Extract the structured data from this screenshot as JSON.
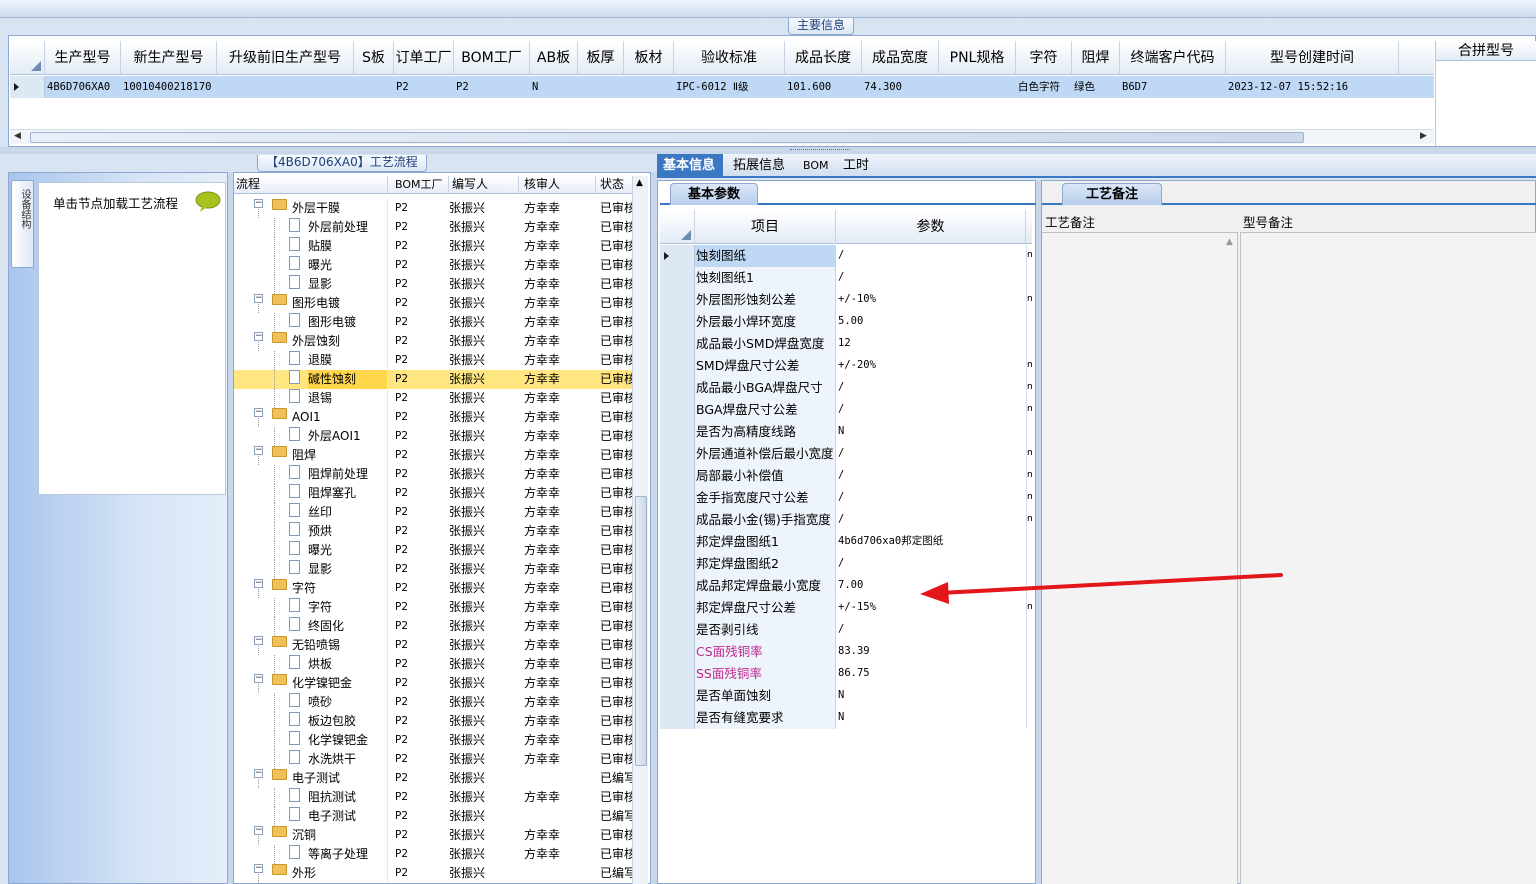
{
  "main_info": {
    "title": "主要信息",
    "combo_header": "合拼型号",
    "columns": [
      "生产型号",
      "新生产型号",
      "升级前旧生产型号",
      "S板",
      "订单工厂",
      "BOM工厂",
      "AB板",
      "板厚",
      "板材",
      "验收标准",
      "成品长度",
      "成品宽度",
      "PNL规格",
      "字符",
      "阻焊",
      "终端客户代码",
      "型号创建时间"
    ],
    "row": [
      "4B6D706XA0",
      "10010400218170",
      "",
      "",
      "P2",
      "P2",
      "N",
      "",
      "",
      "IPC-6012 Ⅱ级",
      "101.600",
      "74.300",
      "",
      "白色字符",
      "绿色",
      "B6D7",
      "2023-12-07 15:52:16"
    ]
  },
  "side": {
    "vertical_tab": "设备结构",
    "click_hint": "单击节点加载工艺流程"
  },
  "process": {
    "title": "【4B6D706XA0】工艺流程",
    "columns": [
      "流程",
      "BOM工厂",
      "编写人",
      "核审人",
      "状态"
    ],
    "rows": [
      {
        "level": 0,
        "name": "外层干膜",
        "factory": "P2",
        "writer": "张振兴",
        "checker": "方幸幸",
        "status": "已审核"
      },
      {
        "level": 1,
        "name": "外层前处理",
        "factory": "P2",
        "writer": "张振兴",
        "checker": "方幸幸",
        "status": "已审核"
      },
      {
        "level": 1,
        "name": "贴膜",
        "factory": "P2",
        "writer": "张振兴",
        "checker": "方幸幸",
        "status": "已审核"
      },
      {
        "level": 1,
        "name": "曝光",
        "factory": "P2",
        "writer": "张振兴",
        "checker": "方幸幸",
        "status": "已审核"
      },
      {
        "level": 1,
        "name": "显影",
        "factory": "P2",
        "writer": "张振兴",
        "checker": "方幸幸",
        "status": "已审核"
      },
      {
        "level": 0,
        "name": "图形电镀",
        "factory": "P2",
        "writer": "张振兴",
        "checker": "方幸幸",
        "status": "已审核"
      },
      {
        "level": 1,
        "name": "图形电镀",
        "factory": "P2",
        "writer": "张振兴",
        "checker": "方幸幸",
        "status": "已审核"
      },
      {
        "level": 0,
        "name": "外层蚀刻",
        "factory": "P2",
        "writer": "张振兴",
        "checker": "方幸幸",
        "status": "已审核"
      },
      {
        "level": 1,
        "name": "退膜",
        "factory": "P2",
        "writer": "张振兴",
        "checker": "方幸幸",
        "status": "已审核"
      },
      {
        "level": 1,
        "name": "碱性蚀刻",
        "factory": "P2",
        "writer": "张振兴",
        "checker": "方幸幸",
        "status": "已审核",
        "selected": true
      },
      {
        "level": 1,
        "name": "退锡",
        "factory": "P2",
        "writer": "张振兴",
        "checker": "方幸幸",
        "status": "已审核"
      },
      {
        "level": 0,
        "name": "AOI1",
        "factory": "P2",
        "writer": "张振兴",
        "checker": "方幸幸",
        "status": "已审核"
      },
      {
        "level": 1,
        "name": "外层AOI1",
        "factory": "P2",
        "writer": "张振兴",
        "checker": "方幸幸",
        "status": "已审核"
      },
      {
        "level": 0,
        "name": "阻焊",
        "factory": "P2",
        "writer": "张振兴",
        "checker": "方幸幸",
        "status": "已审核"
      },
      {
        "level": 1,
        "name": "阻焊前处理",
        "factory": "P2",
        "writer": "张振兴",
        "checker": "方幸幸",
        "status": "已审核"
      },
      {
        "level": 1,
        "name": "阻焊塞孔",
        "factory": "P2",
        "writer": "张振兴",
        "checker": "方幸幸",
        "status": "已审核"
      },
      {
        "level": 1,
        "name": "丝印",
        "factory": "P2",
        "writer": "张振兴",
        "checker": "方幸幸",
        "status": "已审核"
      },
      {
        "level": 1,
        "name": "预烘",
        "factory": "P2",
        "writer": "张振兴",
        "checker": "方幸幸",
        "status": "已审核"
      },
      {
        "level": 1,
        "name": "曝光",
        "factory": "P2",
        "writer": "张振兴",
        "checker": "方幸幸",
        "status": "已审核"
      },
      {
        "level": 1,
        "name": "显影",
        "factory": "P2",
        "writer": "张振兴",
        "checker": "方幸幸",
        "status": "已审核"
      },
      {
        "level": 0,
        "name": "字符",
        "factory": "P2",
        "writer": "张振兴",
        "checker": "方幸幸",
        "status": "已审核"
      },
      {
        "level": 1,
        "name": "字符",
        "factory": "P2",
        "writer": "张振兴",
        "checker": "方幸幸",
        "status": "已审核"
      },
      {
        "level": 1,
        "name": "终固化",
        "factory": "P2",
        "writer": "张振兴",
        "checker": "方幸幸",
        "status": "已审核"
      },
      {
        "level": 0,
        "name": "无铅喷锡",
        "factory": "P2",
        "writer": "张振兴",
        "checker": "方幸幸",
        "status": "已审核"
      },
      {
        "level": 1,
        "name": "烘板",
        "factory": "P2",
        "writer": "张振兴",
        "checker": "方幸幸",
        "status": "已审核"
      },
      {
        "level": 0,
        "name": "化学镍钯金",
        "factory": "P2",
        "writer": "张振兴",
        "checker": "方幸幸",
        "status": "已审核"
      },
      {
        "level": 1,
        "name": "喷砂",
        "factory": "P2",
        "writer": "张振兴",
        "checker": "方幸幸",
        "status": "已审核"
      },
      {
        "level": 1,
        "name": "板边包胶",
        "factory": "P2",
        "writer": "张振兴",
        "checker": "方幸幸",
        "status": "已审核"
      },
      {
        "level": 1,
        "name": "化学镍钯金",
        "factory": "P2",
        "writer": "张振兴",
        "checker": "方幸幸",
        "status": "已审核"
      },
      {
        "level": 1,
        "name": "水洗烘干",
        "factory": "P2",
        "writer": "张振兴",
        "checker": "方幸幸",
        "status": "已审核"
      },
      {
        "level": 0,
        "name": "电子测试",
        "factory": "P2",
        "writer": "张振兴",
        "checker": "",
        "status": "已编写"
      },
      {
        "level": 1,
        "name": "阻抗测试",
        "factory": "P2",
        "writer": "张振兴",
        "checker": "方幸幸",
        "status": "已审核"
      },
      {
        "level": 1,
        "name": "电子测试",
        "factory": "P2",
        "writer": "张振兴",
        "checker": "",
        "status": "已编写"
      },
      {
        "level": 0,
        "name": "沉铜",
        "factory": "P2",
        "writer": "张振兴",
        "checker": "方幸幸",
        "status": "已审核"
      },
      {
        "level": 1,
        "name": "等离子处理",
        "factory": "P2",
        "writer": "张振兴",
        "checker": "方幸幸",
        "status": "已审核"
      },
      {
        "level": 0,
        "name": "外形",
        "factory": "P2",
        "writer": "张振兴",
        "checker": "",
        "status": "已编写"
      }
    ]
  },
  "tabs": [
    "基本信息",
    "拓展信息",
    "BOM",
    "工时"
  ],
  "basic": {
    "subtab": "基本参数",
    "col_item": "项目",
    "col_param": "参数",
    "rows": [
      {
        "label": "蚀刻图纸",
        "value": "/",
        "ex": "m",
        "current": true
      },
      {
        "label": "蚀刻图纸1",
        "value": "/",
        "ex": ""
      },
      {
        "label": "外层图形蚀刻公差",
        "value": "+/-10%",
        "ex": "m"
      },
      {
        "label": "外层最小焊环宽度",
        "value": "5.00",
        "ex": ""
      },
      {
        "label": "成品最小SMD焊盘宽度",
        "value": "12",
        "ex": ""
      },
      {
        "label": "SMD焊盘尺寸公差",
        "value": "+/-20%",
        "ex": "m"
      },
      {
        "label": "成品最小BGA焊盘尺寸",
        "value": "/",
        "ex": "m"
      },
      {
        "label": "BGA焊盘尺寸公差",
        "value": "/",
        "ex": "m"
      },
      {
        "label": "是否为高精度线路",
        "value": "N",
        "ex": ""
      },
      {
        "label": "外层通道补偿后最小宽度",
        "value": "/",
        "ex": "m"
      },
      {
        "label": "局部最小补偿值",
        "value": "/",
        "ex": "m"
      },
      {
        "label": "金手指宽度尺寸公差",
        "value": "/",
        "ex": "m"
      },
      {
        "label": "成品最小金(锡)手指宽度",
        "value": "/",
        "ex": "m"
      },
      {
        "label": "邦定焊盘图纸1",
        "value": "4b6d706xa0邦定图纸",
        "ex": ""
      },
      {
        "label": "邦定焊盘图纸2",
        "value": "/",
        "ex": ""
      },
      {
        "label": "成品邦定焊盘最小宽度",
        "value": "7.00",
        "ex": ""
      },
      {
        "label": "邦定焊盘尺寸公差",
        "value": "+/-15%",
        "ex": "m"
      },
      {
        "label": "是否剥引线",
        "value": "/",
        "ex": ""
      },
      {
        "label": "CS面残铜率",
        "value": "83.39",
        "ex": "",
        "pink": true
      },
      {
        "label": "SS面残铜率",
        "value": "86.75",
        "ex": "",
        "pink": true
      },
      {
        "label": "是否单面蚀刻",
        "value": "N",
        "ex": ""
      },
      {
        "label": "是否有缝宽要求",
        "value": "N",
        "ex": ""
      }
    ]
  },
  "remarks": {
    "tab": "工艺备注",
    "process_remark": "工艺备注",
    "model_remark": "型号备注"
  },
  "colors": {
    "accent": "#3b78c4",
    "arrow": "#e3171b",
    "pink": "#c0278f",
    "selected_row": "#ffe680"
  }
}
